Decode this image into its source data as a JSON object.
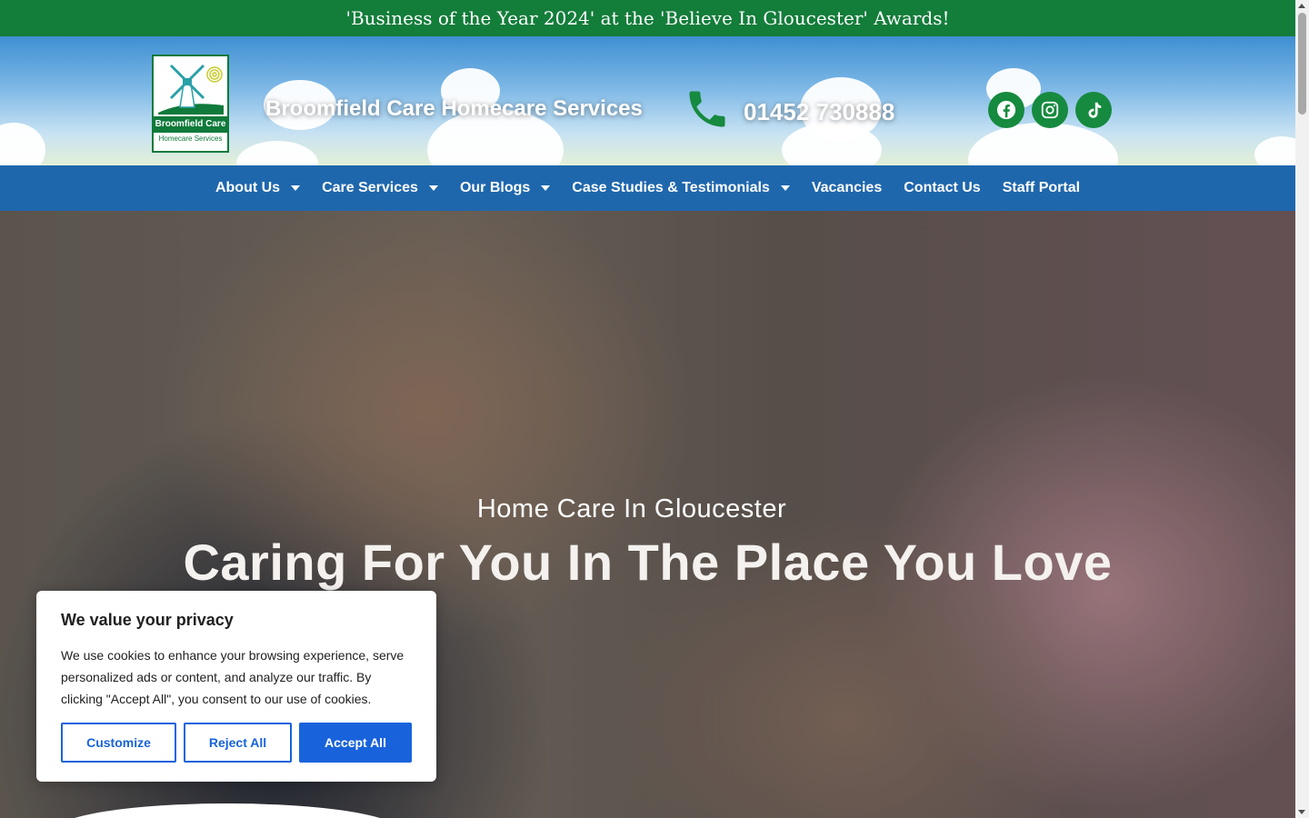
{
  "award_banner": "'Business of the Year 2024' at the 'Believe In Gloucester' Awards!",
  "header": {
    "logo_name": "Broomfield Care",
    "logo_sub": "Homecare Services",
    "site_title": "Broomfield Care Homecare Services",
    "phone": "01452 730888",
    "social": [
      "facebook-icon",
      "instagram-icon",
      "tiktok-icon"
    ]
  },
  "nav": {
    "items": [
      {
        "label": "About Us",
        "dropdown": true
      },
      {
        "label": "Care Services",
        "dropdown": true
      },
      {
        "label": "Our Blogs",
        "dropdown": true
      },
      {
        "label": "Case Studies & Testimonials",
        "dropdown": true
      },
      {
        "label": "Vacancies",
        "dropdown": false
      },
      {
        "label": "Contact Us",
        "dropdown": false
      },
      {
        "label": "Staff Portal",
        "dropdown": false
      }
    ]
  },
  "hero": {
    "subtitle": "Home Care In Gloucester",
    "title": "Caring For You In The Place You Love"
  },
  "cookie": {
    "title": "We value your privacy",
    "text": "We use cookies to enhance your browsing experience, serve personalized ads or content, and analyze our traffic. By clicking \"Accept All\", you consent to our use of cookies.",
    "customize": "Customize",
    "reject": "Reject All",
    "accept": "Accept All"
  },
  "colors": {
    "banner_green": "#137d3a",
    "nav_blue": "#1f67ad",
    "social_green": "#168a3e",
    "cookie_blue": "#1863dc"
  }
}
